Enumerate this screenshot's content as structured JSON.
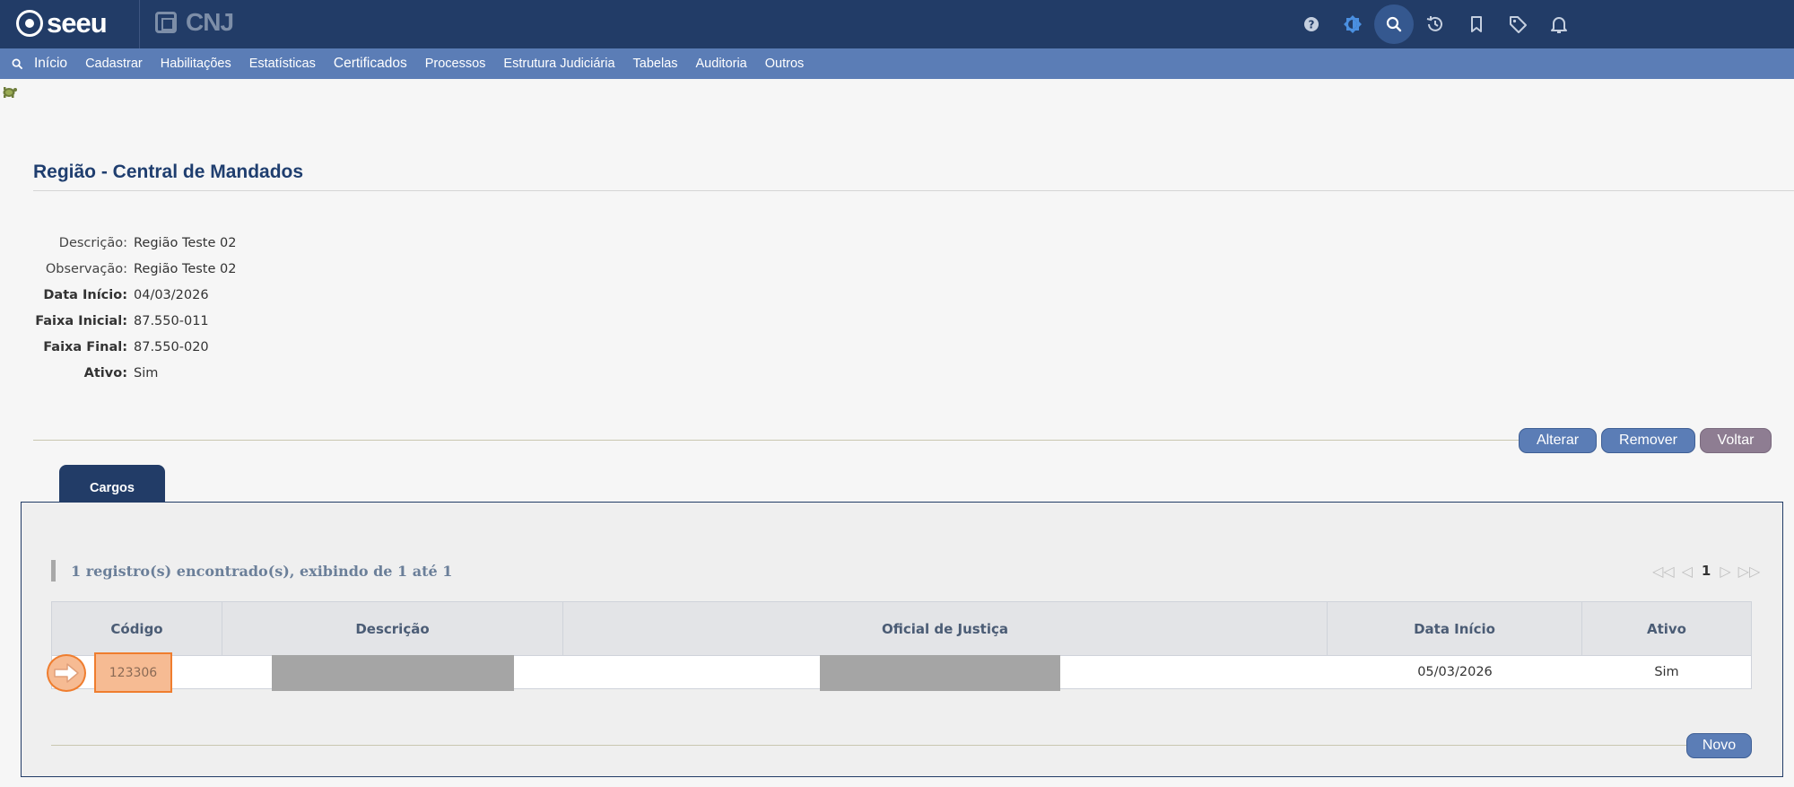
{
  "header": {
    "logo_text": "seeu",
    "cnj_text": "CNJ",
    "icons": [
      "help-icon",
      "contrast-icon",
      "search-icon",
      "history-icon",
      "bookmark-icon",
      "tag-icon",
      "bell-icon"
    ]
  },
  "menu": {
    "items": [
      "Início",
      "Cadastrar",
      "Habilitações",
      "Estatísticas",
      "Certificados",
      "Processos",
      "Estrutura Judiciária",
      "Tabelas",
      "Auditoria",
      "Outros"
    ]
  },
  "page": {
    "title": "Região - Central de Mandados"
  },
  "details": [
    {
      "label": "Descrição:",
      "value": "Região Teste 02"
    },
    {
      "label": "Observação:",
      "value": "Região Teste 02"
    },
    {
      "label": "Data Início:",
      "value": "04/03/2026"
    },
    {
      "label": "Faixa Inicial:",
      "value": "87.550-011"
    },
    {
      "label": "Faixa Final:",
      "value": "87.550-020"
    },
    {
      "label": "Ativo:",
      "value": "Sim"
    }
  ],
  "actions": {
    "alterar": "Alterar",
    "remover": "Remover",
    "voltar": "Voltar"
  },
  "tab": {
    "label": "Cargos"
  },
  "records": {
    "text": "1 registro(s) encontrado(s), exibindo de 1 até 1",
    "current_page": "1"
  },
  "table": {
    "headers": [
      "Código",
      "Descrição",
      "Oficial de Justiça",
      "Data Início",
      "Ativo"
    ],
    "rows": [
      {
        "codigo": "123306",
        "descricao": "",
        "oficial": "",
        "data_inicio": "05/03/2026",
        "ativo": "Sim"
      }
    ]
  },
  "novo_label": "Novo",
  "colors": {
    "topbar": "#223c67",
    "menubar": "#5b7db6",
    "button_blue": "#5b7db6",
    "button_purple": "#8e7d92",
    "highlight": "#f6bb93",
    "highlight_border": "#ef7d2e"
  }
}
